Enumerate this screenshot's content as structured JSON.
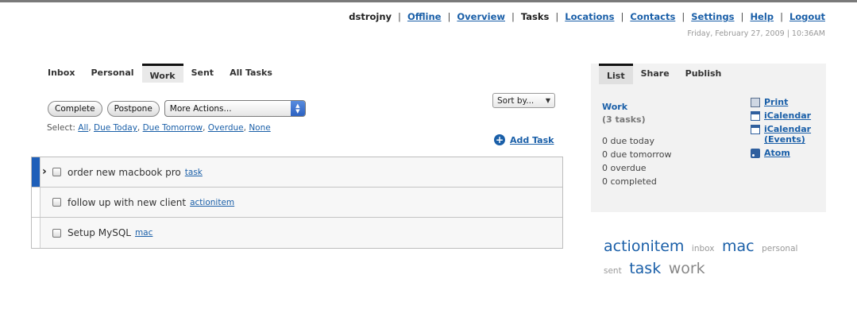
{
  "header": {
    "username": "dstrojny",
    "nav": [
      {
        "label": "Offline",
        "link": true
      },
      {
        "label": "Overview",
        "link": true
      },
      {
        "label": "Tasks",
        "link": false
      },
      {
        "label": "Locations",
        "link": true
      },
      {
        "label": "Contacts",
        "link": true
      },
      {
        "label": "Settings",
        "link": true
      },
      {
        "label": "Help",
        "link": true
      },
      {
        "label": "Logout",
        "link": true
      }
    ],
    "datetime": "Friday, February 27, 2009 | 10:36AM"
  },
  "tabs": {
    "inbox": "Inbox",
    "personal": "Personal",
    "work": "Work",
    "sent": "Sent",
    "all": "All Tasks"
  },
  "toolbar": {
    "complete": "Complete",
    "postpone": "Postpone",
    "more_actions": "More Actions...",
    "sort_by": "Sort by...",
    "add_task": "Add Task"
  },
  "select": {
    "label": "Select:",
    "all": "All",
    "due_today": "Due Today",
    "due_tomorrow": "Due Tomorrow",
    "overdue": "Overdue",
    "none": "None"
  },
  "tasks": [
    {
      "name": "order new macbook pro",
      "tag": "task"
    },
    {
      "name": "follow up with new client",
      "tag": "actionitem"
    },
    {
      "name": "Setup MySQL",
      "tag": "mac"
    }
  ],
  "panel": {
    "tabs": {
      "list": "List",
      "share": "Share",
      "publish": "Publish"
    },
    "list_name": "Work",
    "task_count": "(3 tasks)",
    "stats": {
      "due_today": "0 due today",
      "due_tomorrow": "0 due tomorrow",
      "overdue": "0 overdue",
      "completed": "0 completed"
    },
    "links": {
      "print": "Print",
      "icalendar": "iCalendar",
      "icalendar_events_1": "iCalendar",
      "icalendar_events_2": "(Events)",
      "atom": "Atom"
    }
  },
  "tag_cloud": {
    "actionitem": "actionitem",
    "inbox": "inbox",
    "mac": "mac",
    "personal": "personal",
    "sent": "sent",
    "task": "task",
    "work": "work"
  },
  "colors": {
    "link": "#1a5fa8",
    "current_task_marker": "#1e5fb9",
    "panel_bg": "#f2f2f2"
  }
}
